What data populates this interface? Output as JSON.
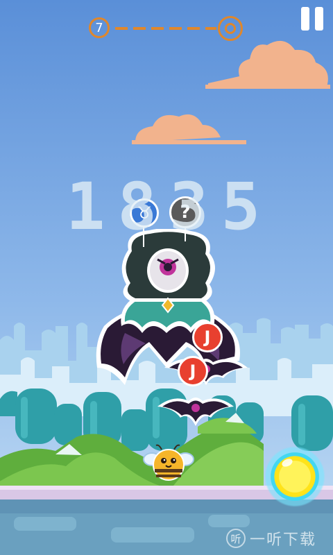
{
  "hud": {
    "level_number": "7",
    "pause_icon": "pause-icon",
    "goal_icon": "target-ring-icon"
  },
  "score": "1835",
  "badges": {
    "taurus": "♉",
    "unknown": "?",
    "j_symbol": "J"
  },
  "characters": {
    "player": "bee",
    "boss": "cloaked-one-eyed-witch",
    "enemies": [
      "bat",
      "bat"
    ]
  },
  "power_button_icon": "yellow-orb-icon",
  "watermark": {
    "icon": "听",
    "text": "一听下载"
  },
  "colors": {
    "sky_top": "#5a8fd8",
    "sky_bottom": "#b8d6f2",
    "accent_orange": "#e0872b",
    "cloud": "#f2b38d",
    "hill_green": "#6cbb45"
  }
}
